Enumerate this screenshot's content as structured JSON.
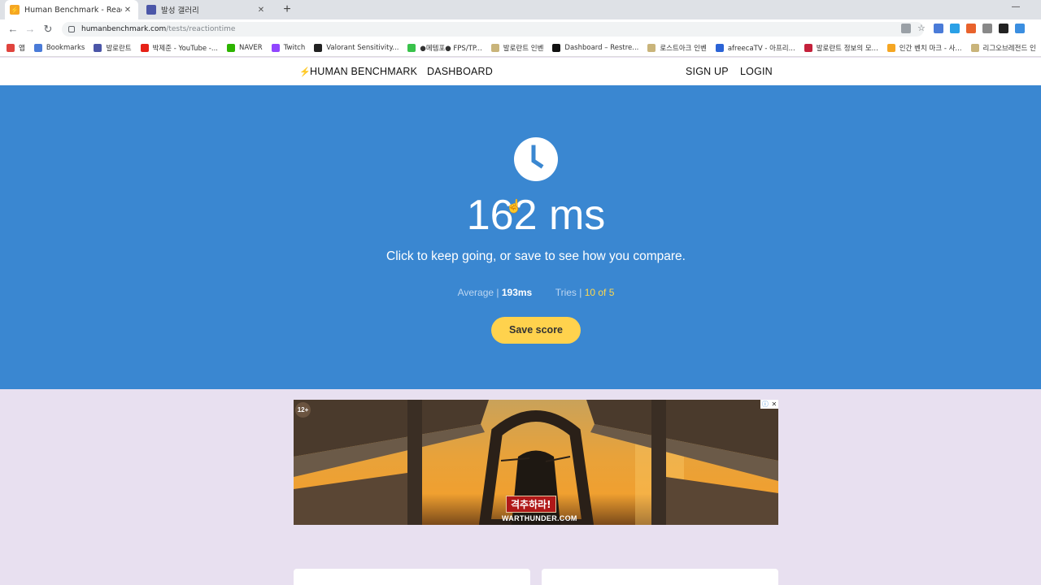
{
  "browser": {
    "tabs": [
      {
        "title": "Human Benchmark - Reaction Ti",
        "favicon": "lightning-icon",
        "favicon_color": "#f5a623"
      },
      {
        "title": "발성 갤러리",
        "favicon": "gallery-icon",
        "favicon_color": "#4b56a8"
      }
    ],
    "new_tab": "+",
    "close": "✕",
    "minimize": "—",
    "url_host": "humanbenchmark.com",
    "url_path": "/tests/reactiontime",
    "bookmarks": [
      {
        "label": "앱",
        "color": "#e0443e"
      },
      {
        "label": "Bookmarks",
        "color": "#4a7bd8"
      },
      {
        "label": "발로란트",
        "color": "#4b56a8"
      },
      {
        "label": "박제준 - YouTube -...",
        "color": "#e62117"
      },
      {
        "label": "NAVER",
        "color": "#2db400"
      },
      {
        "label": "Twitch",
        "color": "#9146ff"
      },
      {
        "label": "Valorant Sensitivity...",
        "color": "#222222"
      },
      {
        "label": "●메템포● FPS/TP...",
        "color": "#39c24b"
      },
      {
        "label": "발로란트 인벤",
        "color": "#c9b47a"
      },
      {
        "label": "Dashboard – Restre...",
        "color": "#111111"
      },
      {
        "label": "로스트아크 인벤",
        "color": "#c9b47a"
      },
      {
        "label": "afreecaTV - 아프리...",
        "color": "#2b63d6"
      },
      {
        "label": "발로란트 정보의 모...",
        "color": "#c4213b"
      },
      {
        "label": "인간 벤치 마크 - 사...",
        "color": "#f5a623"
      },
      {
        "label": "리그오브레전드 인",
        "color": "#c9b47a"
      }
    ]
  },
  "site": {
    "brand": "HUMAN BENCHMARK",
    "dashboard": "DASHBOARD",
    "signup": "SIGN UP",
    "login": "LOGIN"
  },
  "test": {
    "result": "162 ms",
    "subtitle": "Click to keep going, or save to see how you compare.",
    "average_label": "Average | ",
    "average_value": "193ms",
    "tries_label": "Tries | ",
    "tries_value": "10 of 5",
    "save_button": "Save score"
  },
  "ad": {
    "age_rating": "12+",
    "caption": "격추하라!",
    "url": "WARTHUNDER.COM"
  },
  "colors": {
    "hero_bg": "#3a87d1",
    "save_button_bg": "#ffd24d",
    "page_bg": "#e8e0f0"
  }
}
